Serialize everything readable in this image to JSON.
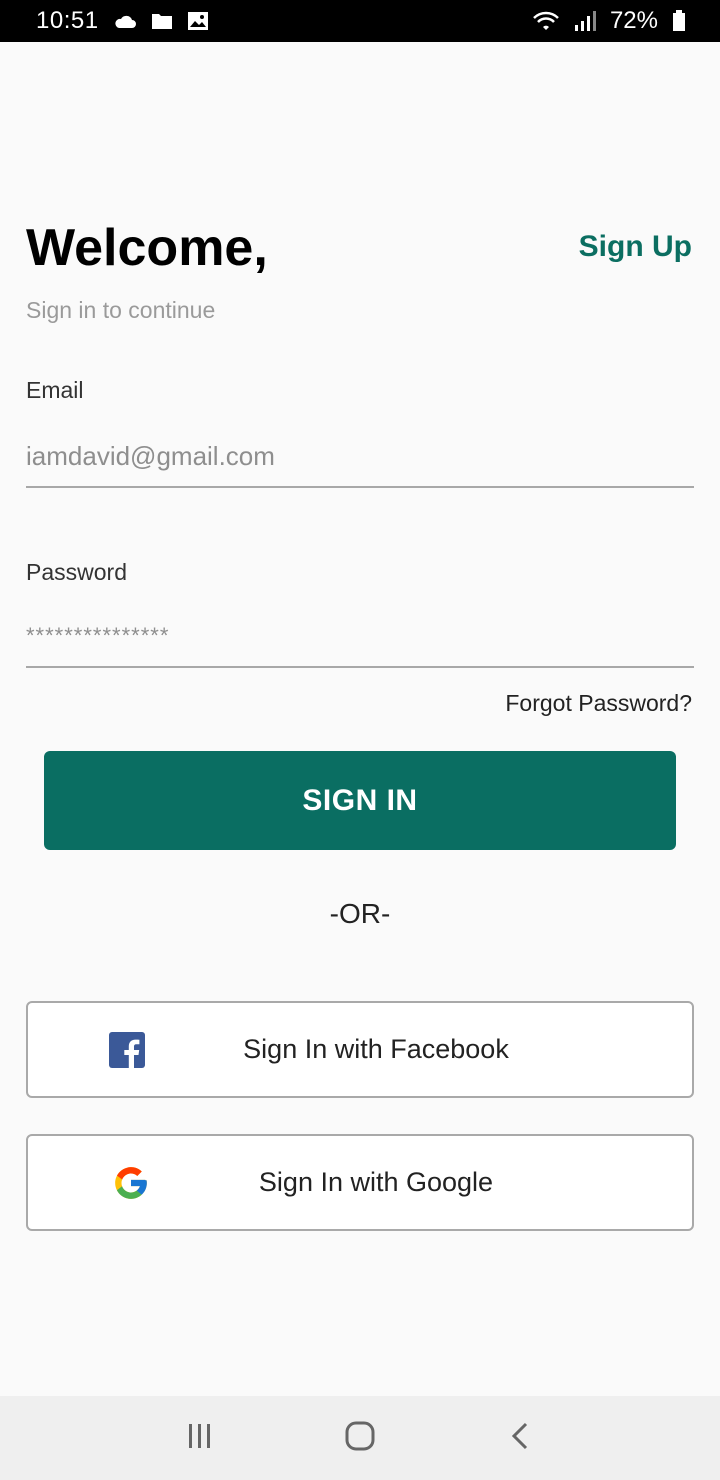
{
  "status_bar": {
    "time": "10:51",
    "battery": "72%",
    "icons": [
      "cloud-icon",
      "folder-icon",
      "image-icon",
      "wifi-icon",
      "signal-icon",
      "battery-icon"
    ]
  },
  "header": {
    "title": "Welcome,",
    "subtitle": "Sign in to continue",
    "signup_label": "Sign Up"
  },
  "form": {
    "email_label": "Email",
    "email_value": "iamdavid@gmail.com",
    "password_label": "Password",
    "password_value": "***************",
    "forgot_label": "Forgot Password?",
    "signin_label": "SIGN IN"
  },
  "divider": "-OR-",
  "social": {
    "facebook_label": "Sign In with Facebook",
    "google_label": "Sign In with Google"
  },
  "colors": {
    "accent": "#0a6e62",
    "facebook": "#3b5998",
    "background": "#fafafa"
  },
  "nav_bar": {
    "icons": [
      "recent-apps-icon",
      "home-icon",
      "back-icon"
    ]
  }
}
